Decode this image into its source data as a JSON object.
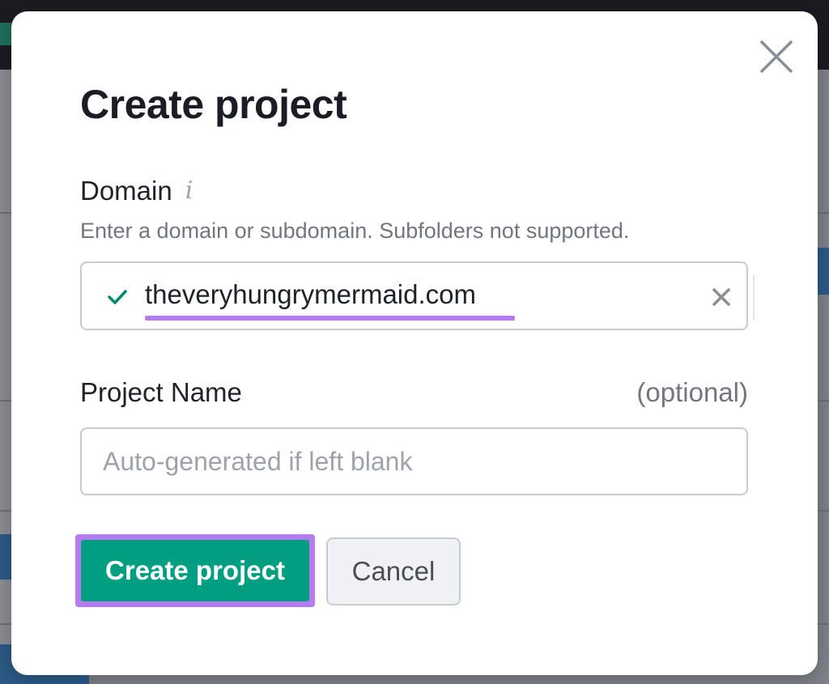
{
  "modal": {
    "title": "Create project",
    "close_icon": "close-icon",
    "domain": {
      "label": "Domain",
      "info_icon": "info-icon",
      "info_glyph": "i",
      "hint": "Enter a domain or subdomain. Subfolders not supported.",
      "value": "theveryhungrymermaid.com",
      "valid_icon": "check-icon",
      "clear_icon": "clear-icon"
    },
    "project_name": {
      "label": "Project Name",
      "optional": "(optional)",
      "value": "",
      "placeholder": "Auto-generated if left blank"
    },
    "buttons": {
      "create": "Create project",
      "cancel": "Cancel"
    }
  },
  "colors": {
    "accent_green": "#009f81",
    "highlight_purple": "#b77bf0",
    "check_green": "#00876c",
    "text_dark": "#1f2229",
    "text_muted": "#727681"
  }
}
